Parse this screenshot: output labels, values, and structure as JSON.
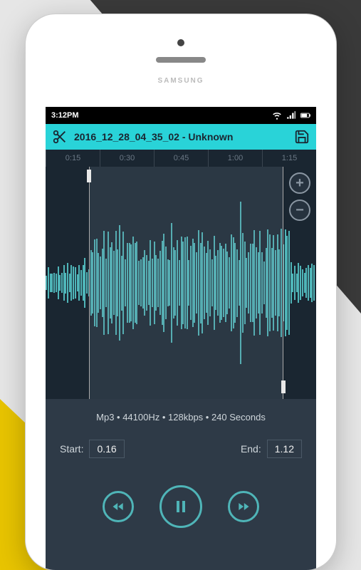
{
  "status": {
    "time": "3:12PM"
  },
  "title": {
    "filename": "2016_12_28_04_35_02 - Unknown"
  },
  "timeline": {
    "t0": "0:15",
    "t1": "0:30",
    "t2": "0:45",
    "t3": "1:00",
    "t4": "1:15"
  },
  "info": {
    "text": "Mp3 • 44100Hz • 128kbps • 240 Seconds"
  },
  "range": {
    "start_label": "Start:",
    "start_value": "0.16",
    "end_label": "End:",
    "end_value": "1.12"
  }
}
